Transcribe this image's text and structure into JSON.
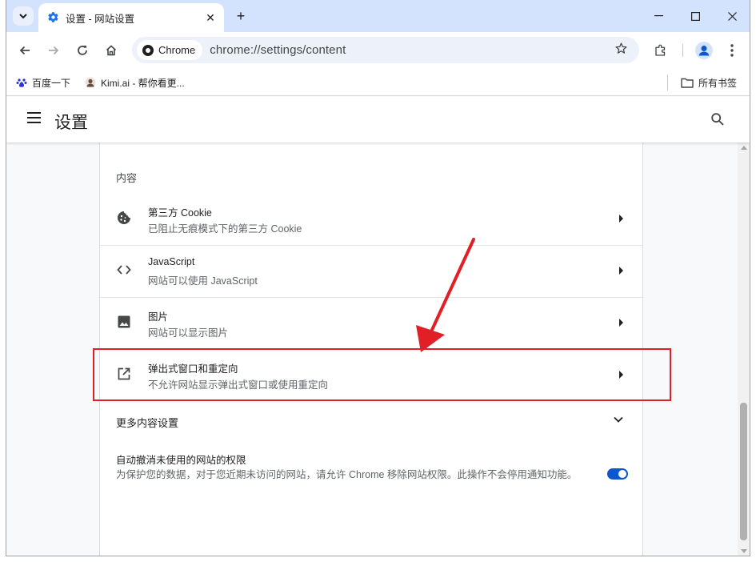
{
  "browser": {
    "tab_title": "设置 - 网站设置",
    "new_tab_symbol": "+",
    "close_symbol": "✕",
    "url": "chrome://settings/content",
    "chrome_chip": "Chrome",
    "window_controls": {
      "minimize": "—",
      "maximize": "☐",
      "close": "✕"
    }
  },
  "bookmarks": {
    "items": [
      {
        "label": "百度一下",
        "icon": "baidu-icon"
      },
      {
        "label": "Kimi.ai - 帮你看更...",
        "icon": "kimi-icon"
      }
    ],
    "all_bookmarks": "所有书签"
  },
  "settings": {
    "title": "设置",
    "section_title": "内容",
    "rows": [
      {
        "title": "第三方 Cookie",
        "subtitle": "已阻止无痕模式下的第三方 Cookie",
        "icon": "cookie-icon"
      },
      {
        "title": "JavaScript",
        "subtitle": "网站可以使用 JavaScript",
        "icon": "code-icon"
      },
      {
        "title": "图片",
        "subtitle": "网站可以显示图片",
        "icon": "image-icon"
      },
      {
        "title": "弹出式窗口和重定向",
        "subtitle": "不允许网站显示弹出式窗口或使用重定向",
        "icon": "open-in-new-icon"
      }
    ],
    "more_settings": "更多内容设置",
    "auto_revoke": {
      "title": "自动撤消未使用的网站的权限",
      "description": "为保护您的数据，对于您近期未访问的网站，请允许 Chrome 移除网站权限。此操作不会停用通知功能。",
      "enabled": true
    }
  },
  "colors": {
    "accent": "#0b57d0",
    "tabstrip": "#d3e3fd",
    "annotation": "#e21f26"
  }
}
